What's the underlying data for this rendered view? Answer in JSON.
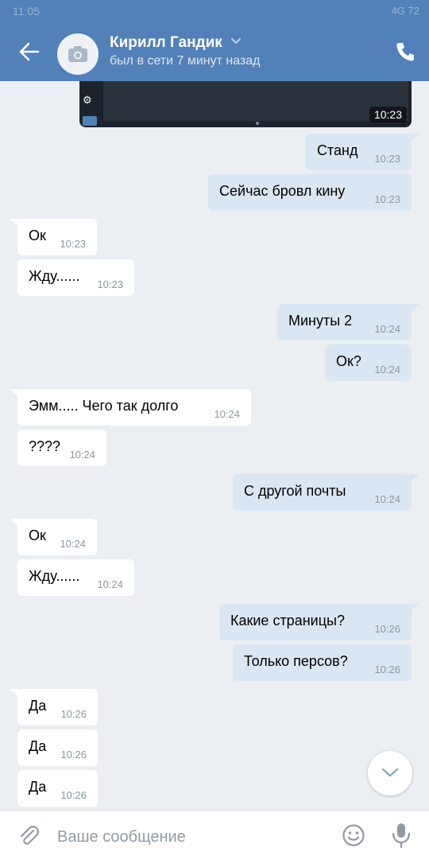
{
  "status_bar": {
    "time": "11:05",
    "network": "4G",
    "battery": "72"
  },
  "header": {
    "contact_name": "Кирилл Гандик",
    "last_seen": "был в сети 7 минут назад"
  },
  "video": {
    "time": "10:23"
  },
  "messages": [
    {
      "dir": "out",
      "text": "Станд",
      "time": "10:23"
    },
    {
      "dir": "out",
      "text": "Сейчас бровл кину",
      "time": "10:23"
    },
    {
      "dir": "in",
      "text": "Ок",
      "time": "10:23"
    },
    {
      "dir": "in",
      "text": "Жду......",
      "time": "10:23"
    },
    {
      "dir": "out",
      "text": "Минуты 2",
      "time": "10:24"
    },
    {
      "dir": "out",
      "text": "Ок?",
      "time": "10:24"
    },
    {
      "dir": "in",
      "text": "Эмм..... Чего так долго",
      "time": "10:24"
    },
    {
      "dir": "in",
      "text": "????",
      "time": "10:24"
    },
    {
      "dir": "out",
      "text": "С другой почты",
      "time": "10:24"
    },
    {
      "dir": "in",
      "text": "Ок",
      "time": "10:24"
    },
    {
      "dir": "in",
      "text": "Жду......",
      "time": "10:24"
    },
    {
      "dir": "out",
      "text": "Какие страницы?",
      "time": "10:26"
    },
    {
      "dir": "out",
      "text": "Только персов?",
      "time": "10:26"
    },
    {
      "dir": "in",
      "text": "Да",
      "time": "10:26"
    },
    {
      "dir": "in",
      "text": "Да",
      "time": "10:26"
    },
    {
      "dir": "in",
      "text": "Да",
      "time": "10:26"
    }
  ],
  "composer": {
    "placeholder": "Ваше сообщение"
  },
  "icons": {
    "back": "arrow-left-icon",
    "avatar": "camera-icon",
    "dropdown": "chevron-down-icon",
    "call": "phone-icon",
    "scroll": "chevron-down-icon",
    "attach": "paperclip-icon",
    "emoji": "smile-icon",
    "voice": "microphone-icon"
  },
  "colors": {
    "header": "#5181b8",
    "outgoing": "#dbe6f4",
    "incoming": "#ffffff",
    "background": "#ebeff3"
  }
}
